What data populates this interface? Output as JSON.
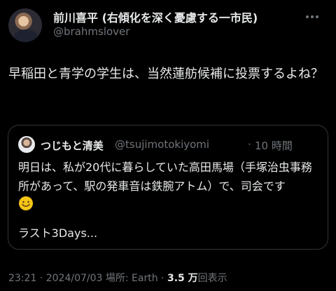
{
  "author": {
    "display_name": "前川喜平 (右傾化を深く憂慮する一市民)",
    "handle": "@brahmslover"
  },
  "tweet": {
    "text": "早稲田と青学の学生は、当然蓮舫候補に投票するよね？"
  },
  "quote": {
    "display_name": "つじもと清美",
    "handle": "@tsujimotokiyomi",
    "separator": "·",
    "time_ago": "10 時間",
    "text": "明日は、私が20代に暮らしていた高田馬場（手塚治虫事務所があって、駅の発車音は鉄腕アトム）で、司会です",
    "emoji": "smiling-face",
    "last_line": "ラスト3Days..."
  },
  "meta": {
    "time": "23:21",
    "sep1": "·",
    "date": "2024/07/03",
    "location": "場所: Earth",
    "sep2": "·",
    "views_count": "3.5 万",
    "views_label": "回表示"
  },
  "colors": {
    "background": "#000000",
    "primary_text": "#e7e9ea",
    "secondary_text": "#71767b",
    "border": "#2f3336"
  },
  "icons": {
    "more": "more-horizontal-icon",
    "emoji": "smiling-face-emoji"
  }
}
